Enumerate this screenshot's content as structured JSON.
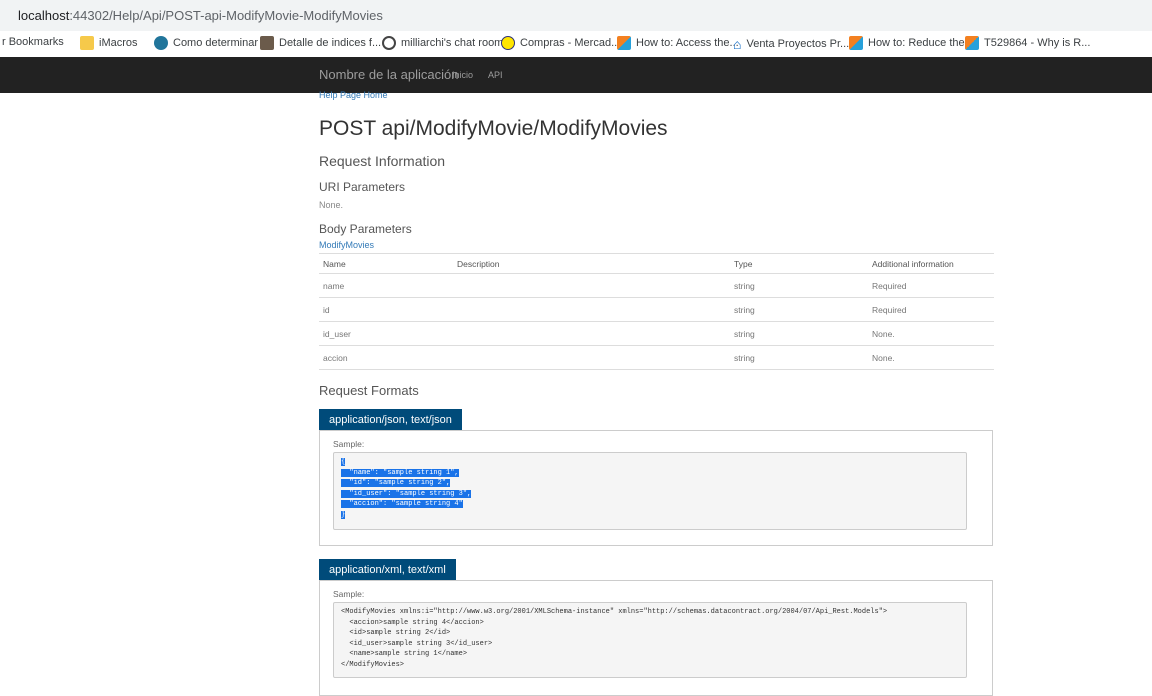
{
  "browser": {
    "url_host": "localhost",
    "url_path": ":44302/Help/Api/POST-api-ModifyMovie-ModifyMovies"
  },
  "bookmarks": [
    {
      "label": "r Bookmarks",
      "icon": "none"
    },
    {
      "label": "iMacros",
      "icon": "folder-icon"
    },
    {
      "label": "Como determinar í...",
      "icon": "wordpress-icon"
    },
    {
      "label": "Detalle de indices f...",
      "icon": "photo-icon"
    },
    {
      "label": "milliarchi's chat room",
      "icon": "chrome-icon"
    },
    {
      "label": "Compras - Mercad...",
      "icon": "mercadolibre-icon"
    },
    {
      "label": "How to: Access the...",
      "icon": "flag-icon"
    },
    {
      "label": "Venta Proyectos Pr...",
      "icon": "home-icon"
    },
    {
      "label": "How to: Reduce the...",
      "icon": "flag-icon"
    },
    {
      "label": "T529864 - Why is R...",
      "icon": "flag-icon"
    }
  ],
  "navbar": {
    "brand": "Nombre de la aplicación",
    "links": [
      "Inicio",
      "API"
    ]
  },
  "page": {
    "breadcrumb": "Help Page Home",
    "title": "POST api/ModifyMovie/ModifyMovies",
    "request_info": "Request Information",
    "uri_params_title": "URI Parameters",
    "uri_params_value": "None.",
    "body_params_title": "Body Parameters",
    "body_params_type_link": "ModifyMovies",
    "table": {
      "headers": [
        "Name",
        "Description",
        "Type",
        "Additional information"
      ],
      "rows": [
        [
          "name",
          "",
          "string",
          "Required"
        ],
        [
          "id",
          "",
          "string",
          "Required"
        ],
        [
          "id_user",
          "",
          "string",
          "None."
        ],
        [
          "accion",
          "",
          "string",
          "None."
        ]
      ]
    },
    "request_formats_title": "Request Formats",
    "json_tab": "application/json, text/json",
    "json_sample_label": "Sample:",
    "json_sample_lines": [
      "{",
      "  \"name\": \"sample string 1\",",
      "  \"id\": \"sample string 2\",",
      "  \"id_user\": \"sample string 3\",",
      "  \"accion\": \"sample string 4\"",
      "}"
    ],
    "xml_tab": "application/xml, text/xml",
    "xml_sample_label": "Sample:",
    "xml_sample_lines": [
      "<ModifyMovies xmlns:i=\"http://www.w3.org/2001/XMLSchema-instance\" xmlns=\"http://schemas.datacontract.org/2004/07/Api_Rest.Models\">",
      "  <accion>sample string 4</accion>",
      "  <id>sample string 2</id>",
      "  <id_user>sample string 3</id_user>",
      "  <name>sample string 1</name>",
      "</ModifyMovies>"
    ]
  }
}
